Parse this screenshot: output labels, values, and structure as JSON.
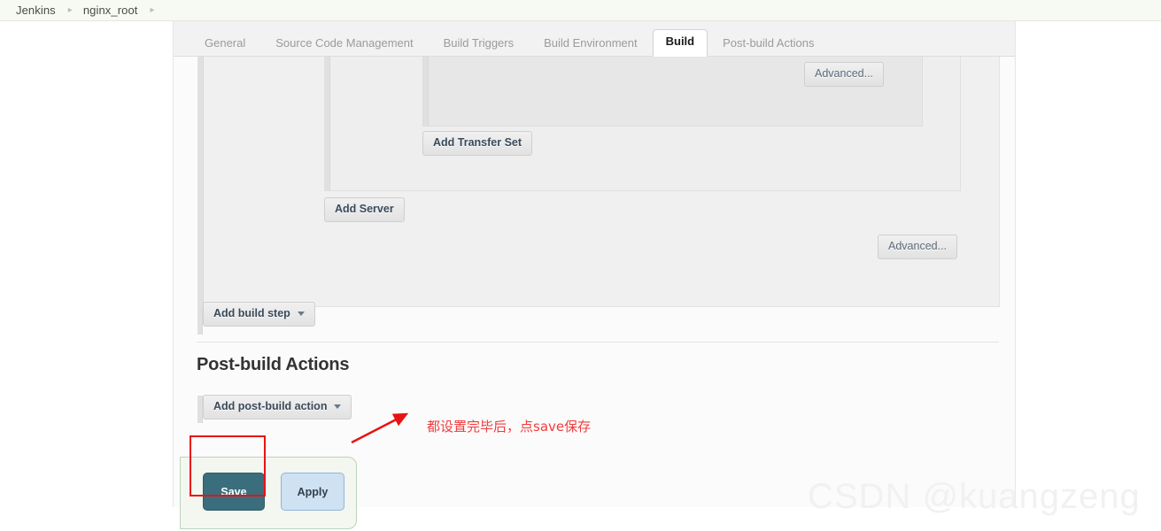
{
  "breadcrumb": {
    "items": [
      {
        "label": "Jenkins"
      },
      {
        "label": "nginx_root"
      }
    ],
    "separator": "▸"
  },
  "tabs": [
    {
      "label": "General",
      "active": false
    },
    {
      "label": "Source Code Management",
      "active": false
    },
    {
      "label": "Build Triggers",
      "active": false
    },
    {
      "label": "Build Environment",
      "active": false
    },
    {
      "label": "Build",
      "active": true
    },
    {
      "label": "Post-build Actions",
      "active": false
    }
  ],
  "build_section": {
    "advanced_inner_label": "Advanced...",
    "add_transfer_set_label": "Add Transfer Set",
    "add_server_label": "Add Server",
    "advanced_outer_label": "Advanced...",
    "add_build_step_label": "Add build step"
  },
  "postbuild_section": {
    "heading": "Post-build Actions",
    "add_postbuild_action_label": "Add post-build action"
  },
  "submit": {
    "save_label": "Save",
    "apply_label": "Apply"
  },
  "annotation": {
    "text": "都设置完毕后，点save保存",
    "color": "#f23b3b",
    "highlight_color": "#e81313"
  },
  "watermark": {
    "text": "CSDN @kuangzeng"
  },
  "colors": {
    "save_bg": "#3b6e7c",
    "apply_bg": "#cfe2f3",
    "panel_bg": "#fbfbfb",
    "tab_bar_bg": "#f2f2f2"
  }
}
